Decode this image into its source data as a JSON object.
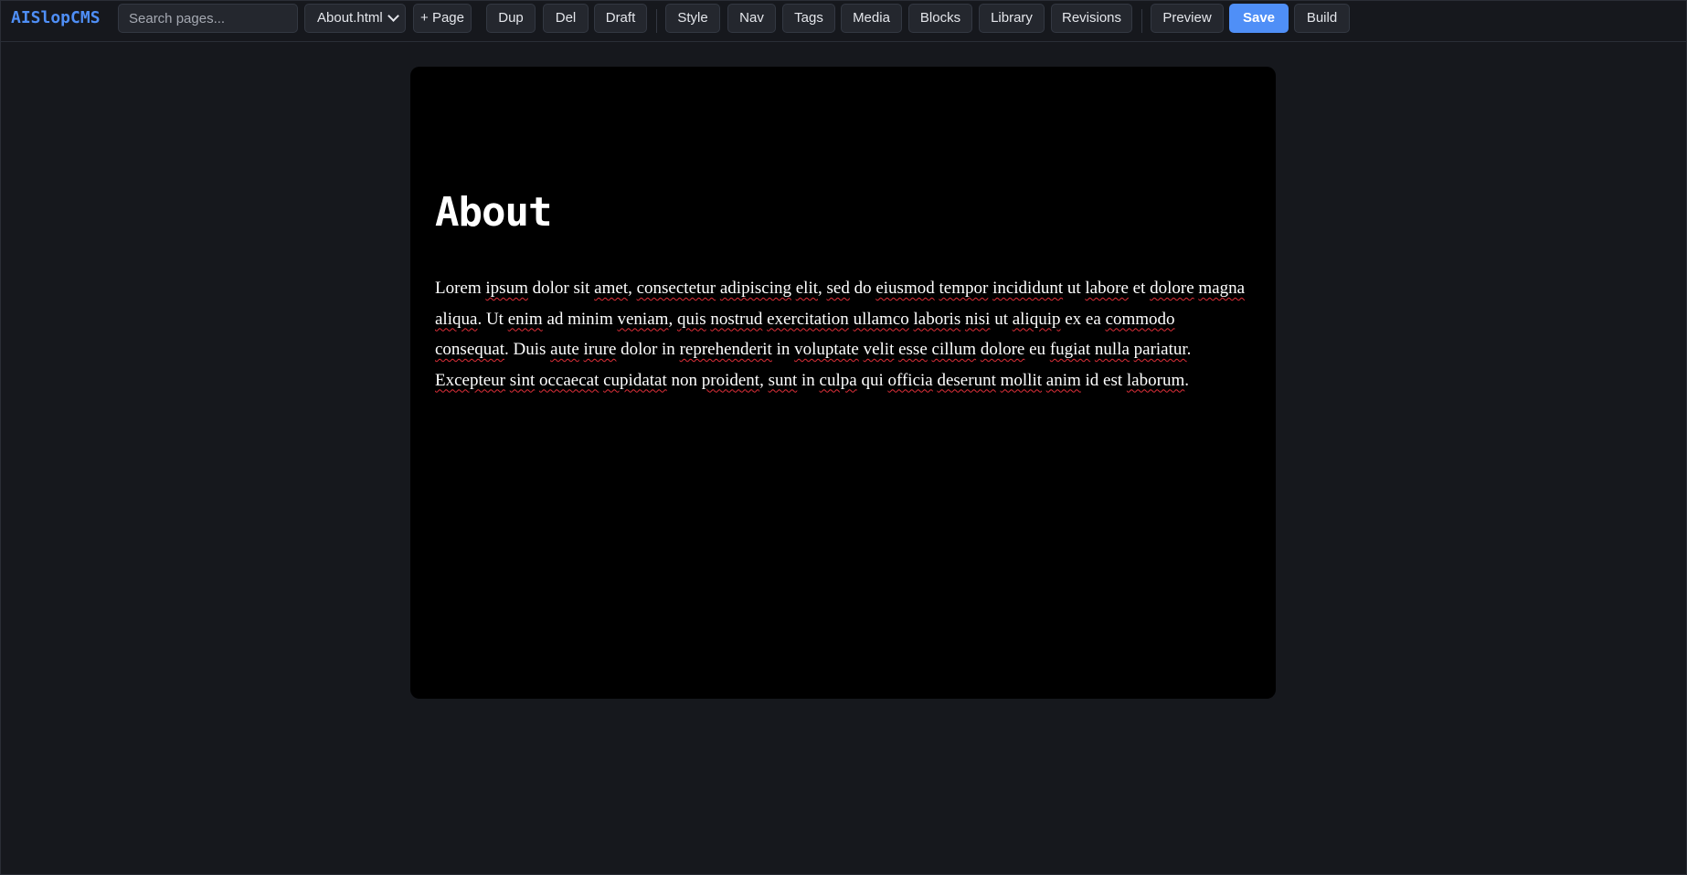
{
  "app": {
    "brand": "AISlopCMS",
    "accent_color": "#4f8ff7",
    "background_color": "#16181d",
    "canvas_color": "#000000"
  },
  "toolbar": {
    "search_placeholder": "Search pages...",
    "page_select": {
      "selected": "About.html"
    },
    "buttons": {
      "add_page": "+ Page",
      "duplicate": "Dup",
      "delete": "Del",
      "draft": "Draft",
      "style": "Style",
      "nav": "Nav",
      "tags": "Tags",
      "media": "Media",
      "blocks": "Blocks",
      "library": "Library",
      "revisions": "Revisions",
      "preview": "Preview",
      "save": "Save",
      "build": "Build"
    }
  },
  "editor": {
    "title": "About",
    "body_words": [
      {
        "t": "Lorem",
        "s": false
      },
      {
        "t": " ",
        "s": false
      },
      {
        "t": "ipsum",
        "s": true
      },
      {
        "t": " dolor sit ",
        "s": false
      },
      {
        "t": "amet",
        "s": true
      },
      {
        "t": ", ",
        "s": false
      },
      {
        "t": "consectetur",
        "s": true
      },
      {
        "t": " ",
        "s": false
      },
      {
        "t": "adipiscing",
        "s": true
      },
      {
        "t": " ",
        "s": false
      },
      {
        "t": "elit",
        "s": true
      },
      {
        "t": ", ",
        "s": false
      },
      {
        "t": "sed",
        "s": true
      },
      {
        "t": " do ",
        "s": false
      },
      {
        "t": "eiusmod",
        "s": true
      },
      {
        "t": " ",
        "s": false
      },
      {
        "t": "tempor",
        "s": true
      },
      {
        "t": " ",
        "s": false
      },
      {
        "t": "incididunt",
        "s": true
      },
      {
        "t": " ut ",
        "s": false
      },
      {
        "t": "labore",
        "s": true
      },
      {
        "t": " et ",
        "s": false
      },
      {
        "t": "dolore",
        "s": true
      },
      {
        "t": " ",
        "s": false
      },
      {
        "t": "magna",
        "s": true
      },
      {
        "t": " ",
        "s": false
      },
      {
        "t": "aliqua",
        "s": true
      },
      {
        "t": ". Ut ",
        "s": false
      },
      {
        "t": "enim",
        "s": true
      },
      {
        "t": " ad minim ",
        "s": false
      },
      {
        "t": "veniam",
        "s": true
      },
      {
        "t": ", ",
        "s": false
      },
      {
        "t": "quis",
        "s": true
      },
      {
        "t": " ",
        "s": false
      },
      {
        "t": "nostrud",
        "s": true
      },
      {
        "t": " ",
        "s": false
      },
      {
        "t": "exercitation",
        "s": true
      },
      {
        "t": " ",
        "s": false
      },
      {
        "t": "ullamco",
        "s": true
      },
      {
        "t": " ",
        "s": false
      },
      {
        "t": "laboris",
        "s": true
      },
      {
        "t": " ",
        "s": false
      },
      {
        "t": "nisi",
        "s": true
      },
      {
        "t": " ut ",
        "s": false
      },
      {
        "t": "aliquip",
        "s": true
      },
      {
        "t": " ex ea ",
        "s": false
      },
      {
        "t": "commodo",
        "s": true
      },
      {
        "t": " ",
        "s": false
      },
      {
        "t": "consequat",
        "s": true
      },
      {
        "t": ". Duis ",
        "s": false
      },
      {
        "t": "aute",
        "s": true
      },
      {
        "t": " ",
        "s": false
      },
      {
        "t": "irure",
        "s": true
      },
      {
        "t": " dolor in ",
        "s": false
      },
      {
        "t": "reprehenderit",
        "s": true
      },
      {
        "t": " in ",
        "s": false
      },
      {
        "t": "voluptate",
        "s": true
      },
      {
        "t": " ",
        "s": false
      },
      {
        "t": "velit",
        "s": true
      },
      {
        "t": " ",
        "s": false
      },
      {
        "t": "esse",
        "s": true
      },
      {
        "t": " ",
        "s": false
      },
      {
        "t": "cillum",
        "s": true
      },
      {
        "t": " ",
        "s": false
      },
      {
        "t": "dolore",
        "s": true
      },
      {
        "t": " eu ",
        "s": false
      },
      {
        "t": "fugiat",
        "s": true
      },
      {
        "t": " ",
        "s": false
      },
      {
        "t": "nulla",
        "s": true
      },
      {
        "t": " ",
        "s": false
      },
      {
        "t": "pariatur",
        "s": true
      },
      {
        "t": ". ",
        "s": false
      },
      {
        "t": "Excepteur",
        "s": true
      },
      {
        "t": " ",
        "s": false
      },
      {
        "t": "sint",
        "s": true
      },
      {
        "t": " ",
        "s": false
      },
      {
        "t": "occaecat",
        "s": true
      },
      {
        "t": " ",
        "s": false
      },
      {
        "t": "cupidatat",
        "s": true
      },
      {
        "t": " non ",
        "s": false
      },
      {
        "t": "proident",
        "s": true
      },
      {
        "t": ", ",
        "s": false
      },
      {
        "t": "sunt",
        "s": true
      },
      {
        "t": " in ",
        "s": false
      },
      {
        "t": "culpa",
        "s": true
      },
      {
        "t": " qui ",
        "s": false
      },
      {
        "t": "officia",
        "s": true
      },
      {
        "t": " ",
        "s": false
      },
      {
        "t": "deserunt",
        "s": true
      },
      {
        "t": " ",
        "s": false
      },
      {
        "t": "mollit",
        "s": true
      },
      {
        "t": " ",
        "s": false
      },
      {
        "t": "anim",
        "s": true
      },
      {
        "t": " id est ",
        "s": false
      },
      {
        "t": "laborum",
        "s": true
      },
      {
        "t": ".",
        "s": false
      }
    ]
  }
}
